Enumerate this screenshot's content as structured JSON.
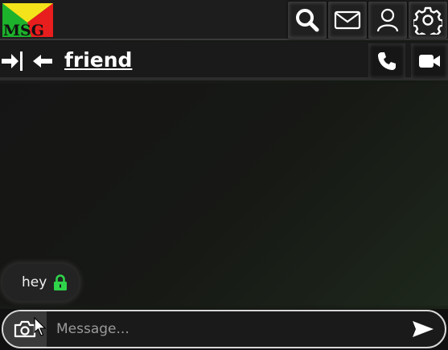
{
  "logo": {
    "text": "MSG"
  },
  "topbar": {
    "search_icon": "search-icon",
    "mail_icon": "mail-icon",
    "profile_icon": "user-icon",
    "settings_icon": "gear-icon"
  },
  "chat_header": {
    "contact_name": "friend",
    "collapse_icon": "arrow-to-right-icon",
    "back_icon": "arrow-left-icon",
    "call_icon": "phone-icon",
    "video_icon": "video-camera-icon"
  },
  "messages": [
    {
      "text": "hey",
      "encrypted": true,
      "lock_color": "#2fd44a"
    }
  ],
  "composer": {
    "placeholder": "Message...",
    "value": "",
    "camera_icon": "camera-icon",
    "send_icon": "send-icon"
  },
  "colors": {
    "lock": "#2fd44a",
    "logo_yellow": "#f4e21a",
    "logo_green": "#1db22b",
    "logo_red": "#e81d1d"
  }
}
